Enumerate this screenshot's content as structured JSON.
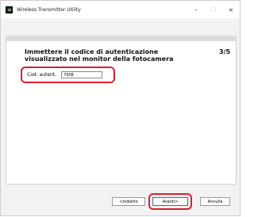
{
  "window": {
    "title": "Wireless Transmitter Utility",
    "minimize_glyph": "–",
    "maximize_glyph": "□",
    "close_glyph": "×"
  },
  "wizard": {
    "instruction": "Immettere il codice di autenticazione visualizzato nel monitor della fotocamera",
    "step_indicator": "3/5",
    "auth_label": "Cod. autent.",
    "auth_value": "7908"
  },
  "buttons": {
    "back_label": "<Indietro",
    "next_label": "Avanti>",
    "cancel_label": "Annulla"
  },
  "colors": {
    "highlight": "#d9202f",
    "window_bg": "#f2f2f2"
  },
  "icons": {
    "app": "wireless-transmitter-app-icon"
  }
}
